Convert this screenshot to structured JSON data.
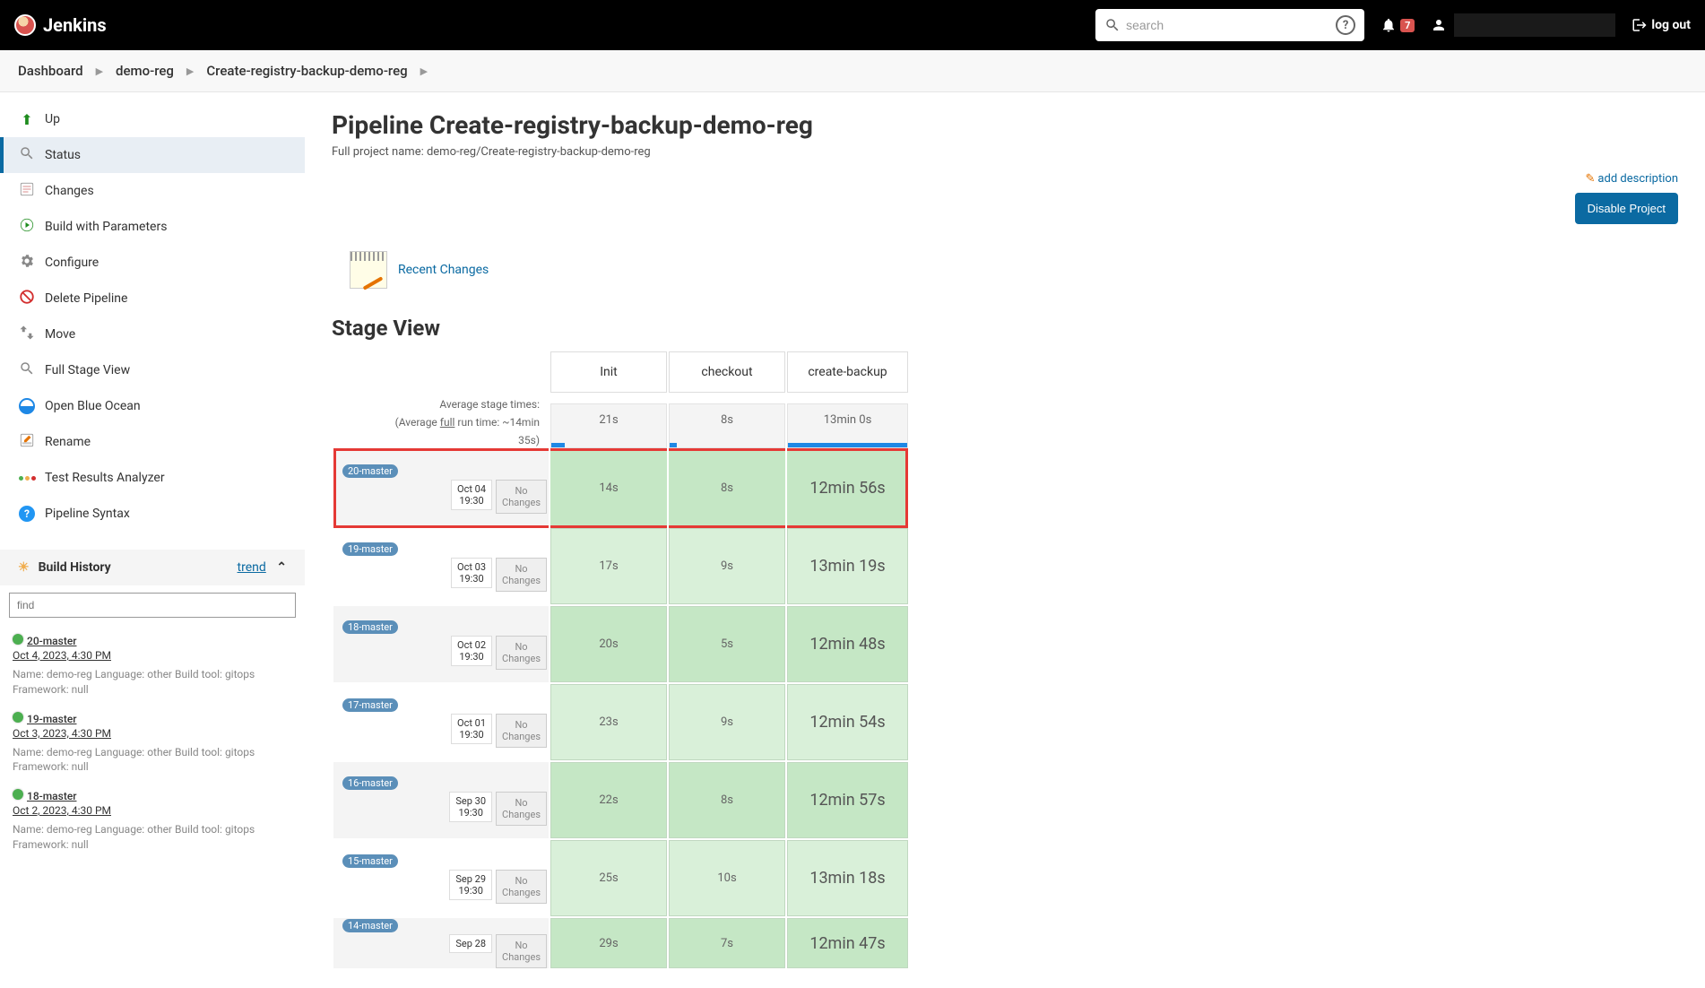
{
  "header": {
    "brand": "Jenkins",
    "search_placeholder": "search",
    "notif_count": "7",
    "logout": "log out"
  },
  "breadcrumbs": [
    "Dashboard",
    "demo-reg",
    "Create-registry-backup-demo-reg"
  ],
  "sidebar": {
    "items": [
      {
        "label": "Up",
        "icon": "up"
      },
      {
        "label": "Status",
        "icon": "magnify",
        "active": true
      },
      {
        "label": "Changes",
        "icon": "changes"
      },
      {
        "label": "Build with Parameters",
        "icon": "play"
      },
      {
        "label": "Configure",
        "icon": "gear"
      },
      {
        "label": "Delete Pipeline",
        "icon": "delete"
      },
      {
        "label": "Move",
        "icon": "move"
      },
      {
        "label": "Full Stage View",
        "icon": "magnify"
      },
      {
        "label": "Open Blue Ocean",
        "icon": "ocean"
      },
      {
        "label": "Rename",
        "icon": "rename"
      },
      {
        "label": "Test Results Analyzer",
        "icon": "test"
      },
      {
        "label": "Pipeline Syntax",
        "icon": "syntax"
      }
    ],
    "build_history": {
      "title": "Build History",
      "trend": "trend",
      "find_placeholder": "find",
      "entries": [
        {
          "name": "20-master",
          "date": "Oct 4, 2023, 4:30 PM",
          "desc": "Name: demo-reg Language: other Build tool: gitops Framework: null"
        },
        {
          "name": "19-master",
          "date": "Oct 3, 2023, 4:30 PM",
          "desc": "Name: demo-reg Language: other Build tool: gitops Framework: null"
        },
        {
          "name": "18-master",
          "date": "Oct 2, 2023, 4:30 PM",
          "desc": "Name: demo-reg Language: other Build tool: gitops Framework: null"
        }
      ]
    }
  },
  "main": {
    "title": "Pipeline Create-registry-backup-demo-reg",
    "subtitle": "Full project name: demo-reg/Create-registry-backup-demo-reg",
    "add_desc": "add description",
    "disable": "Disable Project",
    "recent_changes": "Recent Changes",
    "stage_view_title": "Stage View",
    "stage_headers": [
      "Init",
      "checkout",
      "create-backup"
    ],
    "avg_label_1": "Average stage times:",
    "avg_label_2a": "(Average ",
    "avg_label_2b": "full",
    "avg_label_2c": " run time: ~14min",
    "avg_label_3": "35s)",
    "avg_values": [
      "21s",
      "8s",
      "13min 0s"
    ],
    "runs": [
      {
        "badge": "20-master",
        "date1": "Oct 04",
        "date2": "19:30",
        "changes": "No Changes",
        "cells": [
          "14s",
          "8s",
          "12min 56s"
        ],
        "highlight": true
      },
      {
        "badge": "19-master",
        "date1": "Oct 03",
        "date2": "19:30",
        "changes": "No Changes",
        "cells": [
          "17s",
          "9s",
          "13min 19s"
        ]
      },
      {
        "badge": "18-master",
        "date1": "Oct 02",
        "date2": "19:30",
        "changes": "No Changes",
        "cells": [
          "20s",
          "5s",
          "12min 48s"
        ]
      },
      {
        "badge": "17-master",
        "date1": "Oct 01",
        "date2": "19:30",
        "changes": "No Changes",
        "cells": [
          "23s",
          "9s",
          "12min 54s"
        ]
      },
      {
        "badge": "16-master",
        "date1": "Sep 30",
        "date2": "19:30",
        "changes": "No Changes",
        "cells": [
          "22s",
          "8s",
          "12min 57s"
        ]
      },
      {
        "badge": "15-master",
        "date1": "Sep 29",
        "date2": "19:30",
        "changes": "No Changes",
        "cells": [
          "25s",
          "10s",
          "13min 18s"
        ]
      },
      {
        "badge": "14-master",
        "date1": "Sep 28",
        "date2": "",
        "changes": "No Changes",
        "cells": [
          "29s",
          "7s",
          "12min 47s"
        ],
        "partial": true
      }
    ]
  }
}
